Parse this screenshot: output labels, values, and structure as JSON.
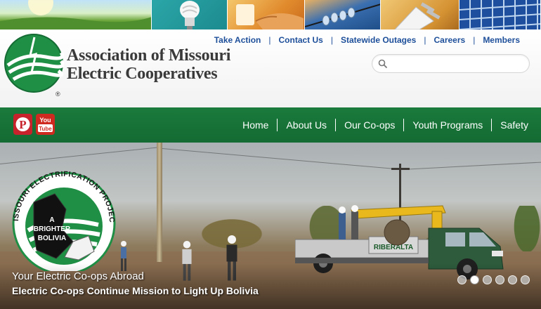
{
  "banner": {
    "tiles": [
      "green-field",
      "light-bulb",
      "hand-switch",
      "power-line",
      "electric-plug",
      "solar-panel"
    ]
  },
  "header": {
    "org_name_line1": "Association of Missouri",
    "org_name_line2": "Electric Cooperatives",
    "registered_mark": "®",
    "top_links": [
      "Take Action",
      "Contact Us",
      "Statewide Outages",
      "Careers",
      "Members"
    ],
    "search": {
      "placeholder": "",
      "value": ""
    }
  },
  "nav": {
    "social": [
      {
        "name": "Pinterest",
        "icon": "pinterest-icon",
        "glyph": "P",
        "color": "#c8232c"
      },
      {
        "name": "YouTube",
        "icon": "youtube-icon",
        "glyph_top": "You",
        "glyph_bottom": "Tube",
        "color": "#cf2a1f"
      }
    ],
    "items": [
      "Home",
      "About Us",
      "Our Co-ops",
      "Youth Programs",
      "Safety"
    ]
  },
  "hero": {
    "badge": {
      "arc_text": "MISSOURI ELECTRIFICATION PROJECT",
      "line1": "A",
      "line2": "BRIGHTER",
      "line3": "BOLIVIA"
    },
    "truck_text": "RIBERALTA",
    "caption_title": "Your Electric Co-ops Abroad",
    "caption_subtitle": "Electric Co-ops Continue Mission to Light Up Bolivia",
    "slides_total": 6,
    "active_slide": 2
  },
  "colors": {
    "brand_green": "#1a7a3c",
    "link_blue": "#1e4f9a",
    "logo_green": "#1f8f45"
  }
}
